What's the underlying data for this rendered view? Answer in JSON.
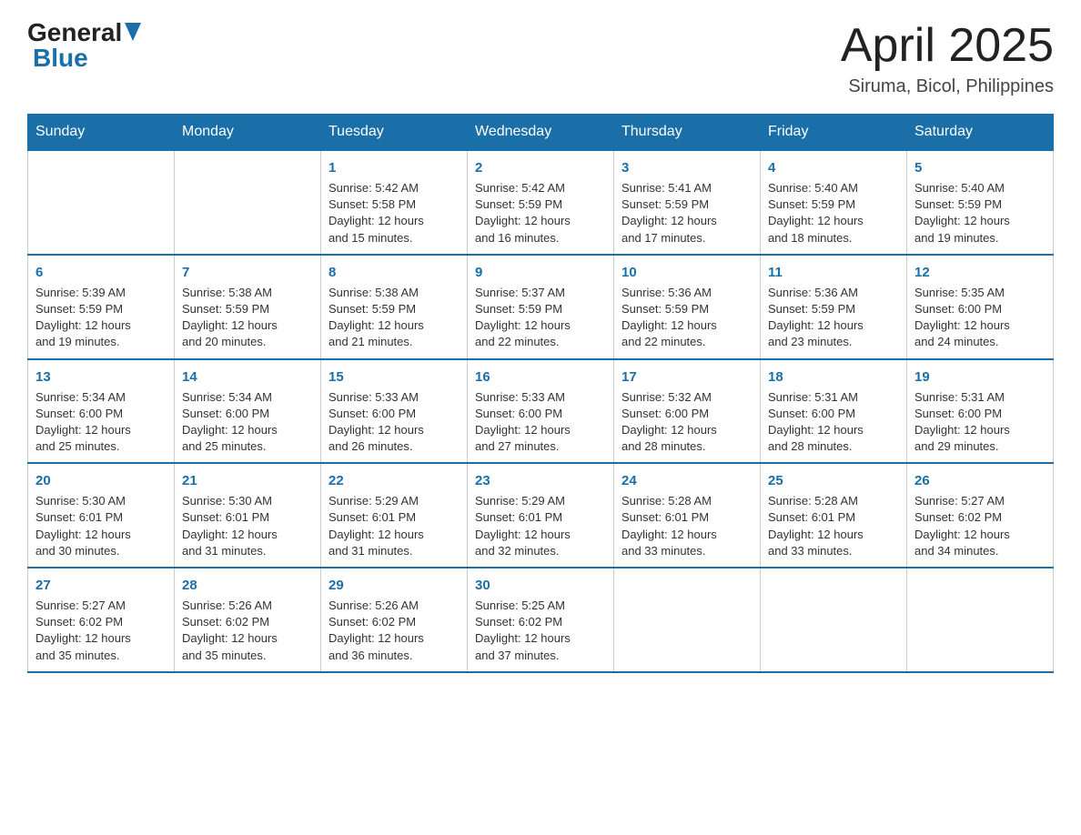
{
  "header": {
    "logo_general": "General",
    "logo_blue": "Blue",
    "main_title": "April 2025",
    "subtitle": "Siruma, Bicol, Philippines"
  },
  "days_of_week": [
    "Sunday",
    "Monday",
    "Tuesday",
    "Wednesday",
    "Thursday",
    "Friday",
    "Saturday"
  ],
  "weeks": [
    [
      {
        "day": "",
        "info": ""
      },
      {
        "day": "",
        "info": ""
      },
      {
        "day": "1",
        "info": "Sunrise: 5:42 AM\nSunset: 5:58 PM\nDaylight: 12 hours\nand 15 minutes."
      },
      {
        "day": "2",
        "info": "Sunrise: 5:42 AM\nSunset: 5:59 PM\nDaylight: 12 hours\nand 16 minutes."
      },
      {
        "day": "3",
        "info": "Sunrise: 5:41 AM\nSunset: 5:59 PM\nDaylight: 12 hours\nand 17 minutes."
      },
      {
        "day": "4",
        "info": "Sunrise: 5:40 AM\nSunset: 5:59 PM\nDaylight: 12 hours\nand 18 minutes."
      },
      {
        "day": "5",
        "info": "Sunrise: 5:40 AM\nSunset: 5:59 PM\nDaylight: 12 hours\nand 19 minutes."
      }
    ],
    [
      {
        "day": "6",
        "info": "Sunrise: 5:39 AM\nSunset: 5:59 PM\nDaylight: 12 hours\nand 19 minutes."
      },
      {
        "day": "7",
        "info": "Sunrise: 5:38 AM\nSunset: 5:59 PM\nDaylight: 12 hours\nand 20 minutes."
      },
      {
        "day": "8",
        "info": "Sunrise: 5:38 AM\nSunset: 5:59 PM\nDaylight: 12 hours\nand 21 minutes."
      },
      {
        "day": "9",
        "info": "Sunrise: 5:37 AM\nSunset: 5:59 PM\nDaylight: 12 hours\nand 22 minutes."
      },
      {
        "day": "10",
        "info": "Sunrise: 5:36 AM\nSunset: 5:59 PM\nDaylight: 12 hours\nand 22 minutes."
      },
      {
        "day": "11",
        "info": "Sunrise: 5:36 AM\nSunset: 5:59 PM\nDaylight: 12 hours\nand 23 minutes."
      },
      {
        "day": "12",
        "info": "Sunrise: 5:35 AM\nSunset: 6:00 PM\nDaylight: 12 hours\nand 24 minutes."
      }
    ],
    [
      {
        "day": "13",
        "info": "Sunrise: 5:34 AM\nSunset: 6:00 PM\nDaylight: 12 hours\nand 25 minutes."
      },
      {
        "day": "14",
        "info": "Sunrise: 5:34 AM\nSunset: 6:00 PM\nDaylight: 12 hours\nand 25 minutes."
      },
      {
        "day": "15",
        "info": "Sunrise: 5:33 AM\nSunset: 6:00 PM\nDaylight: 12 hours\nand 26 minutes."
      },
      {
        "day": "16",
        "info": "Sunrise: 5:33 AM\nSunset: 6:00 PM\nDaylight: 12 hours\nand 27 minutes."
      },
      {
        "day": "17",
        "info": "Sunrise: 5:32 AM\nSunset: 6:00 PM\nDaylight: 12 hours\nand 28 minutes."
      },
      {
        "day": "18",
        "info": "Sunrise: 5:31 AM\nSunset: 6:00 PM\nDaylight: 12 hours\nand 28 minutes."
      },
      {
        "day": "19",
        "info": "Sunrise: 5:31 AM\nSunset: 6:00 PM\nDaylight: 12 hours\nand 29 minutes."
      }
    ],
    [
      {
        "day": "20",
        "info": "Sunrise: 5:30 AM\nSunset: 6:01 PM\nDaylight: 12 hours\nand 30 minutes."
      },
      {
        "day": "21",
        "info": "Sunrise: 5:30 AM\nSunset: 6:01 PM\nDaylight: 12 hours\nand 31 minutes."
      },
      {
        "day": "22",
        "info": "Sunrise: 5:29 AM\nSunset: 6:01 PM\nDaylight: 12 hours\nand 31 minutes."
      },
      {
        "day": "23",
        "info": "Sunrise: 5:29 AM\nSunset: 6:01 PM\nDaylight: 12 hours\nand 32 minutes."
      },
      {
        "day": "24",
        "info": "Sunrise: 5:28 AM\nSunset: 6:01 PM\nDaylight: 12 hours\nand 33 minutes."
      },
      {
        "day": "25",
        "info": "Sunrise: 5:28 AM\nSunset: 6:01 PM\nDaylight: 12 hours\nand 33 minutes."
      },
      {
        "day": "26",
        "info": "Sunrise: 5:27 AM\nSunset: 6:02 PM\nDaylight: 12 hours\nand 34 minutes."
      }
    ],
    [
      {
        "day": "27",
        "info": "Sunrise: 5:27 AM\nSunset: 6:02 PM\nDaylight: 12 hours\nand 35 minutes."
      },
      {
        "day": "28",
        "info": "Sunrise: 5:26 AM\nSunset: 6:02 PM\nDaylight: 12 hours\nand 35 minutes."
      },
      {
        "day": "29",
        "info": "Sunrise: 5:26 AM\nSunset: 6:02 PM\nDaylight: 12 hours\nand 36 minutes."
      },
      {
        "day": "30",
        "info": "Sunrise: 5:25 AM\nSunset: 6:02 PM\nDaylight: 12 hours\nand 37 minutes."
      },
      {
        "day": "",
        "info": ""
      },
      {
        "day": "",
        "info": ""
      },
      {
        "day": "",
        "info": ""
      }
    ]
  ]
}
